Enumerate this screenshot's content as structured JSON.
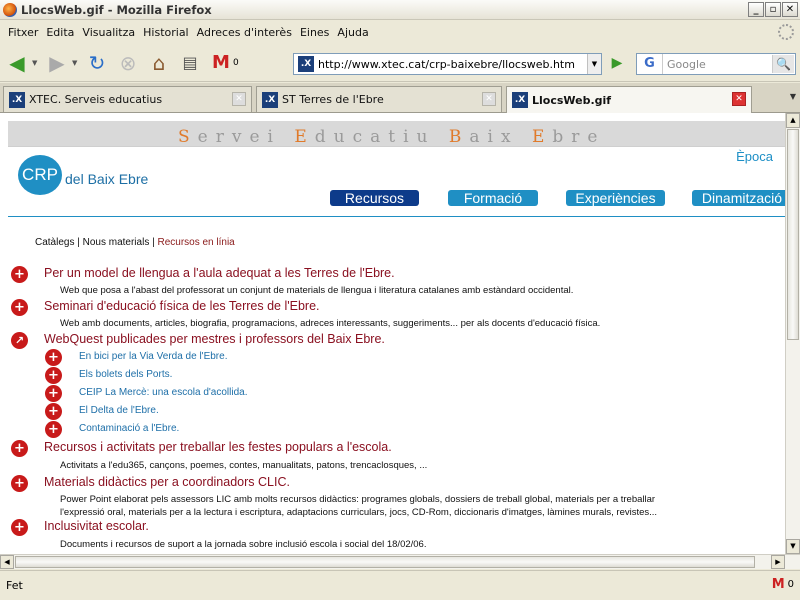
{
  "window": {
    "title": "LlocsWeb.gif - Mozilla Firefox"
  },
  "menu": [
    "Fitxer",
    "Edita",
    "Visualitza",
    "Historial",
    "Adreces d'interès",
    "Eines",
    "Ajuda"
  ],
  "toolbar": {
    "url": "http://www.xtec.cat/crp-baixebre/llocsweb.htm",
    "search_placeholder": "Google",
    "gmail_count": "0"
  },
  "tabs": [
    {
      "label": "XTEC. Serveis educatius"
    },
    {
      "label": "ST Terres de l'Ebre"
    },
    {
      "label": "LlocsWeb.gif"
    }
  ],
  "status": {
    "text": "Fet",
    "gmail_count": "0"
  },
  "page": {
    "banner": [
      "S",
      "ervei ",
      "E",
      "ducatiu ",
      "B",
      "aix ",
      "E",
      "bre"
    ],
    "logo_circle": "CRP",
    "logo_text": "del Baix Ebre",
    "epoca": "Època",
    "nav": [
      "Recursos",
      "Formació",
      "Experiències",
      "Dinamització"
    ],
    "crumb_a": "Catàlegs",
    "crumb_b": "Nous materials",
    "crumb_c": "Recursos en línia",
    "entries": [
      {
        "title": "Per un model de llengua a l'aula adequat a les Terres de l'Ebre.",
        "desc": [
          "Web que posa a l'abast del professorat un conjunt de materials de llengua i literatura catalanes amb estàndard occidental."
        ]
      },
      {
        "title": "Seminari d'educació física de les Terres de l'Ebre.",
        "desc": [
          "Web amb documents, articles, biografia, programacions, adreces interessants, suggeriments... per als docents d'educació física."
        ]
      },
      {
        "title": "WebQuest publicades per mestres i professors del Baix Ebre.",
        "desc": []
      },
      {
        "title": "Recursos i activitats per treballar les festes populars a l'escola.",
        "desc": [
          "Activitats a l'edu365, cançons, poemes, contes, manualitats, patons, trencaclosques, ..."
        ]
      },
      {
        "title": "Materials didàctics per a coordinadors CLIC.",
        "desc": [
          "Power Point elaborat pels assessors LIC amb molts recursos didàctics: programes globals, dossiers de treball global, materials per a treballar",
          "l'expressió oral, materials per a la lectura i escriptura, adaptacions curriculars, jocs, CD-Rom, diccionaris d'imatges, làmines murals, revistes..."
        ]
      },
      {
        "title": "Inclusivitat escolar.",
        "desc": [
          "Documents i recursos de suport a la jornada sobre inclusió escola i social del 18/02/06."
        ]
      }
    ],
    "webquests": [
      "En bici per la Via Verda de l'Ebre.",
      "Els bolets dels Ports.",
      "CEIP La Mercè: una escola d'acollida.",
      "El Delta de l'Ebre.",
      "Contaminació a l'Ebre."
    ]
  }
}
